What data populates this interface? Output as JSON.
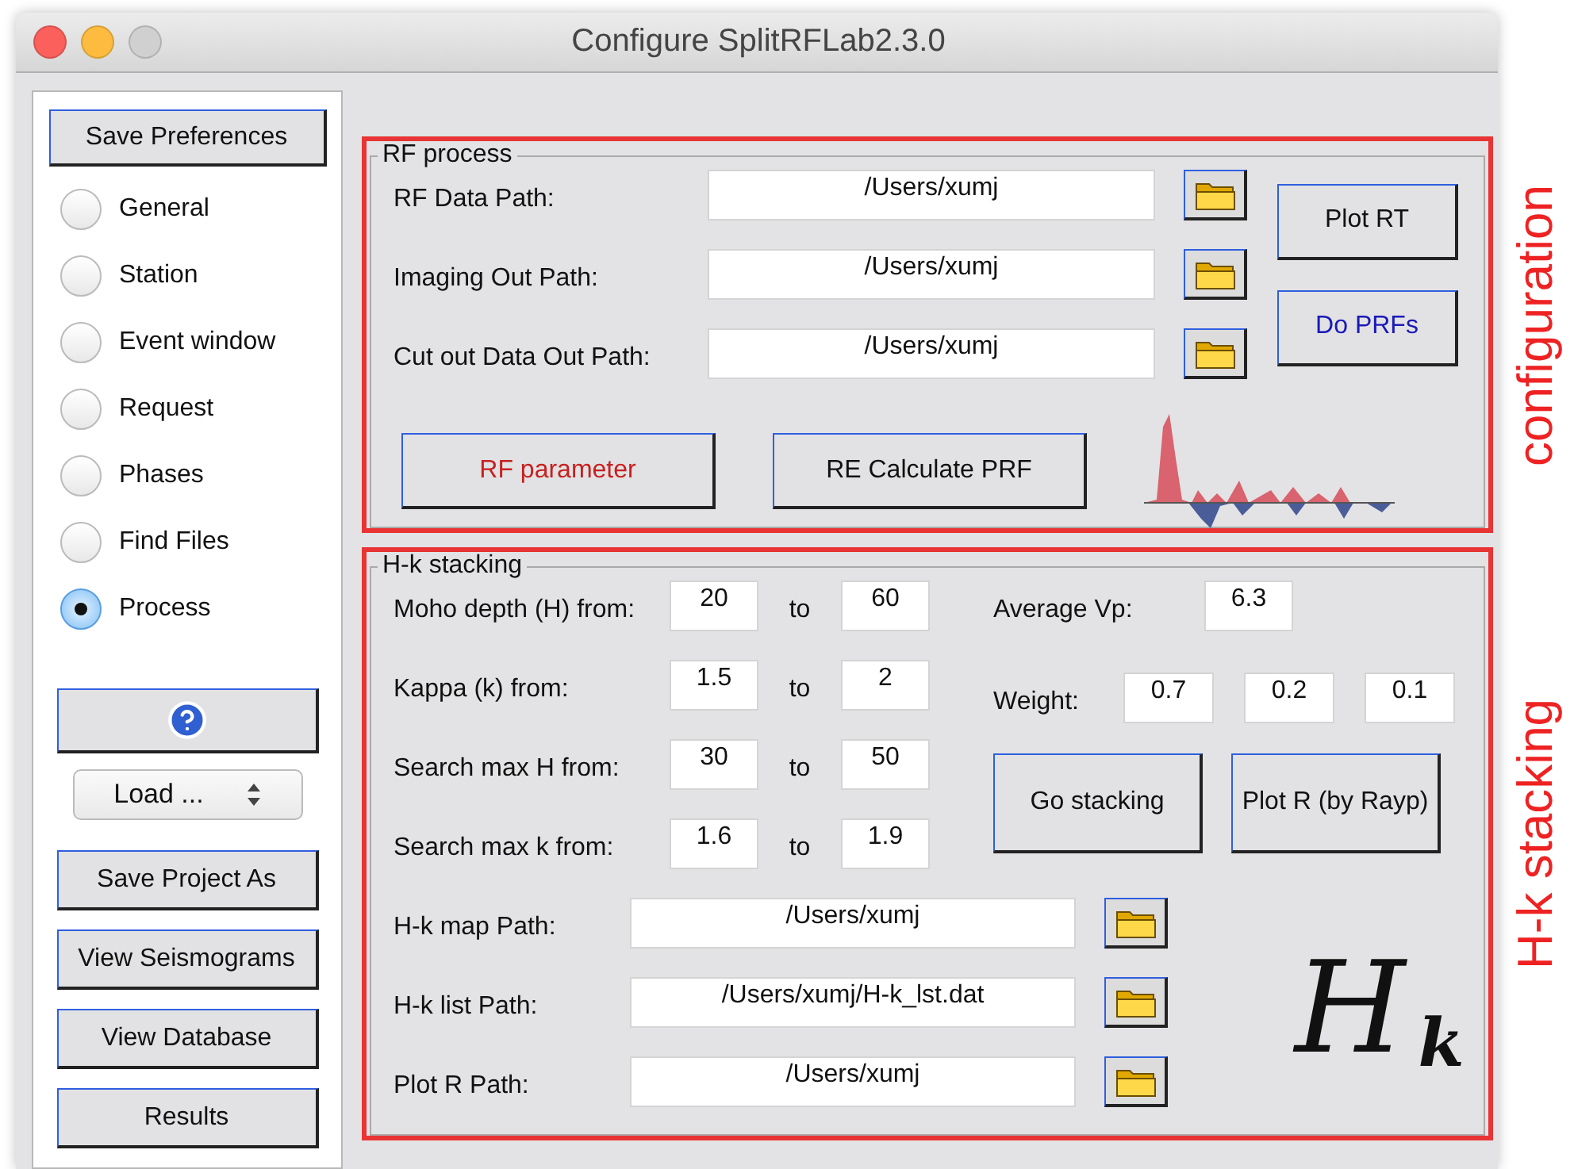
{
  "window": {
    "title": "Configure SplitRFLab2.3.0"
  },
  "sidebar": {
    "save_button": "Save Preferences",
    "options": [
      {
        "label": "General",
        "selected": false
      },
      {
        "label": "Station",
        "selected": false
      },
      {
        "label": "Event window",
        "selected": false
      },
      {
        "label": "Request",
        "selected": false
      },
      {
        "label": "Phases",
        "selected": false
      },
      {
        "label": "Find Files",
        "selected": false
      },
      {
        "label": "Process",
        "selected": true
      }
    ],
    "load_select": {
      "value": "Load ..."
    },
    "buttons": [
      "Save Project As",
      "View Seismograms",
      "View Database",
      "Results"
    ]
  },
  "rf_process": {
    "title": "RF process",
    "annotation": "configuration",
    "paths": [
      {
        "label": "RF Data Path:",
        "value": "/Users/xumj"
      },
      {
        "label": "Imaging Out Path:",
        "value": "/Users/xumj"
      },
      {
        "label": "Cut out Data Out Path:",
        "value": "/Users/xumj"
      }
    ],
    "side_buttons": [
      {
        "label": "Plot RT",
        "color": "#111111"
      },
      {
        "label": "Do PRFs",
        "color": "#1a1ab8"
      }
    ],
    "buttons": [
      {
        "label": "RF parameter",
        "color": "#c82020"
      },
      {
        "label": "RE Calculate PRF",
        "color": "#111111"
      }
    ]
  },
  "hk_stacking": {
    "title": "H-k stacking",
    "annotation": "H-k stacking",
    "ranges": [
      {
        "label": "Moho depth (H) from:",
        "from": "20",
        "to_label": "to",
        "to": "60"
      },
      {
        "label": "Kappa (k) from:",
        "from": "1.5",
        "to_label": "to",
        "to": "2"
      },
      {
        "label": "Search max H from:",
        "from": "30",
        "to_label": "to",
        "to": "50"
      },
      {
        "label": "Search max k from:",
        "from": "1.6",
        "to_label": "to",
        "to": "1.9"
      }
    ],
    "average_vp": {
      "label": "Average Vp:",
      "value": "6.3"
    },
    "weight": {
      "label": "Weight:",
      "values": [
        "0.7",
        "0.2",
        "0.1"
      ]
    },
    "buttons": [
      "Go stacking",
      "Plot R (by Rayp)"
    ],
    "paths": [
      {
        "label": "H-k map Path:",
        "value": "/Users/xumj"
      },
      {
        "label": "H-k list Path:",
        "value": "/Users/xumj/H-k_lst.dat"
      },
      {
        "label": "Plot R Path:",
        "value": "/Users/xumj"
      }
    ],
    "logo": {
      "main": "H",
      "sub": "k"
    }
  }
}
